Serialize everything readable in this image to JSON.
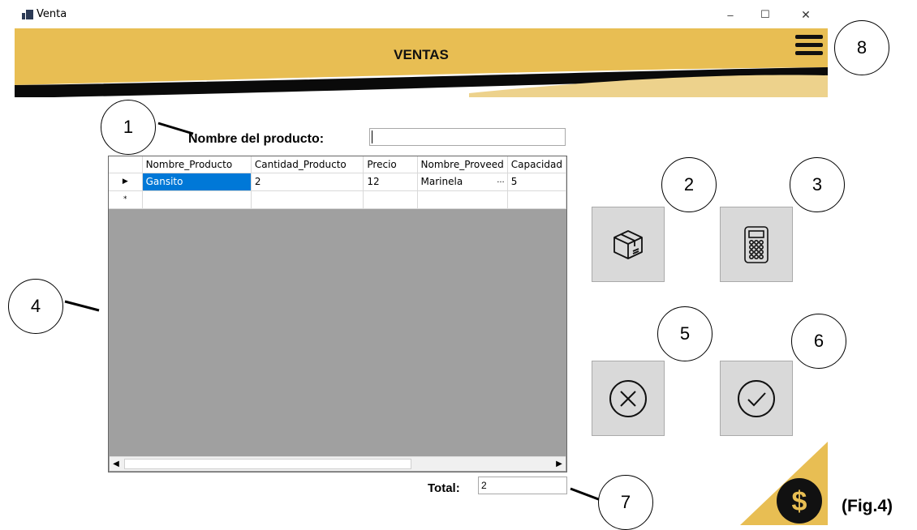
{
  "window": {
    "title": "Venta",
    "minimize": "–",
    "maximize": "☐",
    "close": "✕"
  },
  "header": {
    "title": "VENTAS",
    "accent": "#E8BE53",
    "dark": "#0a0a0a"
  },
  "search": {
    "label": "Nombre del producto:",
    "value": ""
  },
  "grid": {
    "columns": [
      "Nombre_Producto",
      "Cantidad_Producto",
      "Precio",
      "Nombre_Proveed",
      "Capacidad"
    ],
    "rows": [
      {
        "marker": "▶",
        "cells": [
          "Gansito",
          "2",
          "12",
          "Marinela",
          "5"
        ],
        "ellipsis": "..."
      },
      {
        "marker": "*",
        "cells": [
          "",
          "",
          "",
          "",
          ""
        ]
      }
    ]
  },
  "buttons": {
    "product": "box-icon",
    "calculate": "calculator-icon",
    "cancel": "cancel-circle-icon",
    "confirm": "check-circle-icon"
  },
  "total": {
    "label": "Total:",
    "value": "2"
  },
  "callouts": [
    "1",
    "2",
    "3",
    "4",
    "5",
    "6",
    "7",
    "8"
  ],
  "figure_label": "(Fig.4)"
}
